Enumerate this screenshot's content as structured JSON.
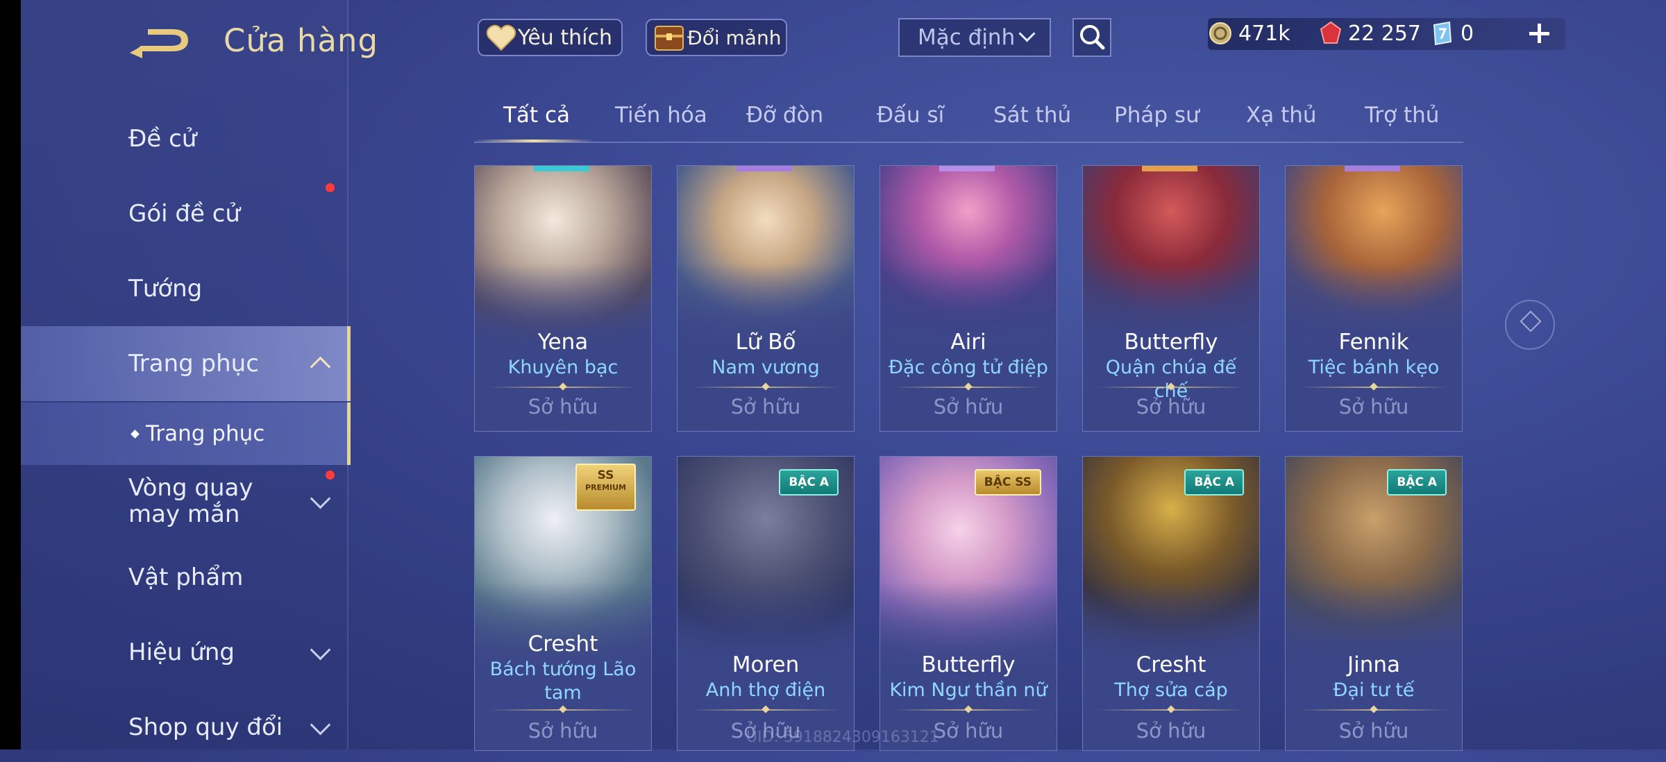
{
  "header": {
    "title": "Cửa hàng",
    "favorites_label": "Yêu thích",
    "exchange_label": "Đổi mảnh",
    "sort": {
      "selected": "Mặc định"
    }
  },
  "currencies": [
    {
      "icon": "gold-coin-icon",
      "value": "471k"
    },
    {
      "icon": "ruby-gem-icon",
      "value": "22 257"
    },
    {
      "icon": "voucher-icon",
      "value": "0"
    }
  ],
  "sidebar": {
    "items": [
      {
        "label": "Đề cử"
      },
      {
        "label": "Gói đề cử"
      },
      {
        "label": "Tướng"
      },
      {
        "label": "Trang phục"
      },
      {
        "label": "Trang phục"
      },
      {
        "label": "Vòng quay may mắn"
      },
      {
        "label": "Vật phẩm"
      },
      {
        "label": "Hiệu ứng"
      },
      {
        "label": "Shop quy đổi"
      }
    ]
  },
  "tabs": [
    "Tất cả",
    "Tiến hóa",
    "Đỡ đòn",
    "Đấu sĩ",
    "Sát thủ",
    "Pháp sư",
    "Xạ thủ",
    "Trợ thủ"
  ],
  "cards": [
    {
      "hero": "Yena",
      "skin": "Khuyên bạc",
      "status": "Sở hữu"
    },
    {
      "hero": "Lữ Bố",
      "skin": "Nam vương",
      "status": "Sở hữu"
    },
    {
      "hero": "Airi",
      "skin": "Đặc công tử điệp",
      "status": "Sở hữu"
    },
    {
      "hero": "Butterfly",
      "skin": "Quận chúa đế chế",
      "status": "Sở hữu"
    },
    {
      "hero": "Fennik",
      "skin": "Tiệc bánh kẹo",
      "status": "Sở hữu"
    },
    {
      "hero": "Cresht",
      "skin": "Bách tướng Lão tam",
      "status": "Sở hữu",
      "badge": "SS",
      "badge_sub": "PREMIUM"
    },
    {
      "hero": "Moren",
      "skin": "Anh thợ điện",
      "status": "Sở hữu",
      "badge": "BẬC A"
    },
    {
      "hero": "Butterfly",
      "skin": "Kim Ngư thần nữ",
      "status": "Sở hữu",
      "badge": "BẬC SS"
    },
    {
      "hero": "Cresht",
      "skin": "Thợ sửa cáp",
      "status": "Sở hữu",
      "badge": "BẬC A"
    },
    {
      "hero": "Jinna",
      "skin": "Đại tư tế",
      "status": "Sở hữu",
      "badge": "BẬC A"
    }
  ],
  "footer": {
    "uid": "UID: 5918824309163121"
  },
  "colors": {
    "accent_gold": "#e9d9a6",
    "skin_name": "#8fd7ff",
    "owned": "#8e96c7",
    "alert_dot": "#ff3b3b"
  }
}
